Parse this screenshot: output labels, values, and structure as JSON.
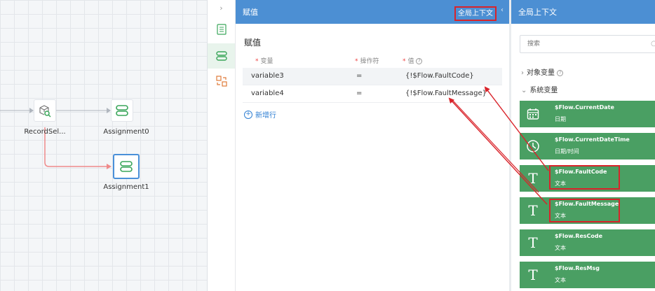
{
  "assign_panel": {
    "header_title": "赋值",
    "global_context_button": "全局上下文",
    "section_title": "赋值",
    "columns": {
      "variable": "变量",
      "operator": "操作符",
      "value": "值"
    },
    "rows": [
      {
        "variable": "variable3",
        "operator": "=",
        "value": "{!$Flow.FaultCode}"
      },
      {
        "variable": "variable4",
        "operator": "=",
        "value": "{!$Flow.FaultMessage}"
      }
    ],
    "add_row": "新增行"
  },
  "canvas": {
    "nodes": {
      "record_select": "RecordSel...",
      "assignment0": "Assignment0",
      "assignment1": "Assignment1"
    }
  },
  "context_panel": {
    "header_title": "全局上下文",
    "search_placeholder": "搜索",
    "groups": {
      "object_vars": "对象变量",
      "system_vars": "系统变量"
    },
    "system_variables": [
      {
        "name": "$Flow.CurrentDate",
        "type": "日期",
        "icon": "calendar-icon"
      },
      {
        "name": "$Flow.CurrentDateTime",
        "type": "日期/时间",
        "icon": "clock-icon"
      },
      {
        "name": "$Flow.FaultCode",
        "type": "文本",
        "icon": "text-t-icon"
      },
      {
        "name": "$Flow.FaultMessage",
        "type": "文本",
        "icon": "text-t-icon"
      },
      {
        "name": "$Flow.ResCode",
        "type": "文本",
        "icon": "text-t-icon"
      },
      {
        "name": "$Flow.ResMsg",
        "type": "文本",
        "icon": "text-t-icon"
      }
    ]
  },
  "colors": {
    "header_blue": "#4c8fd3",
    "card_green": "#4a9f63",
    "annotation_red": "#d9232a",
    "node_green": "#3aa65a",
    "selection_blue": "#4a90d9"
  }
}
